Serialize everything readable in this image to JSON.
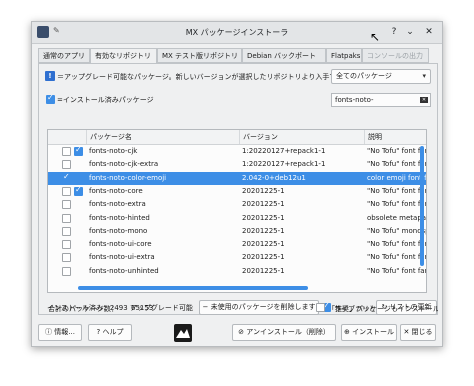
{
  "window": {
    "title": "MX パッケージインストーラ"
  },
  "tabs": [
    {
      "label": "通常のアプリ"
    },
    {
      "label": "有効なリポジトリ"
    },
    {
      "label": "MX テスト版リポジトリ"
    },
    {
      "label": "Debian バックポート"
    },
    {
      "label": "Flatpaks"
    },
    {
      "label": "コンソールの出力"
    }
  ],
  "legend": {
    "upgrade_badge": "!",
    "upgrade_text": "＝アップグレード可能なパッケージ。新しいバージョンが選択したリポジトリより入手でき",
    "installed_text": "=インストール済みパッケージ"
  },
  "filter": {
    "selected": "全てのパッケージ"
  },
  "search": {
    "value": "fonts-noto-"
  },
  "table": {
    "headers": [
      "パッケージ名",
      "バージョン",
      "説明"
    ],
    "rows": [
      {
        "checked": false,
        "installed": true,
        "name": "fonts-noto-cjk",
        "version": "1:20220127+repack1-1",
        "desc": "\"No Tofu\" font famili",
        "selected": false
      },
      {
        "checked": false,
        "installed": false,
        "name": "fonts-noto-cjk-extra",
        "version": "1:20220127+repack1-1",
        "desc": "\"No Tofu\" font famili",
        "selected": false
      },
      {
        "checked": true,
        "installed": false,
        "name": "fonts-noto-color-emoji",
        "version": "2.042-0+deb12u1",
        "desc": "color emoji font from",
        "selected": true
      },
      {
        "checked": false,
        "installed": true,
        "name": "fonts-noto-core",
        "version": "20201225-1",
        "desc": "\"No Tofu\" font famili",
        "selected": false
      },
      {
        "checked": false,
        "installed": false,
        "name": "fonts-noto-extra",
        "version": "20201225-1",
        "desc": "\"No Tofu\" font famili",
        "selected": false
      },
      {
        "checked": false,
        "installed": false,
        "name": "fonts-noto-hinted",
        "version": "20201225-1",
        "desc": "obsolete metapacka",
        "selected": false
      },
      {
        "checked": false,
        "installed": false,
        "name": "fonts-noto-mono",
        "version": "20201225-1",
        "desc": "\"No Tofu\" monospac",
        "selected": false
      },
      {
        "checked": false,
        "installed": false,
        "name": "fonts-noto-ui-core",
        "version": "20201225-1",
        "desc": "\"No Tofu\" font famili",
        "selected": false
      },
      {
        "checked": false,
        "installed": false,
        "name": "fonts-noto-ui-extra",
        "version": "20201225-1",
        "desc": "\"No Tofu\" font famili",
        "selected": false
      },
      {
        "checked": false,
        "installed": false,
        "name": "fonts-noto-unhinted",
        "version": "20201225-1",
        "desc": "\"No Tofu\" font famili",
        "selected": false
      }
    ]
  },
  "stats": {
    "total_label": "合計のパッケージ数：",
    "total_value": "65153",
    "installed_line": "インストール済み：2493  アップグレード可能"
  },
  "actions": {
    "remove_unused": "未使用のパッケージを削除します",
    "libraries": "ライブラリと開",
    "refresh_list": "リストの更新",
    "recommends": "「推奨」パッケージもインストール"
  },
  "footer": {
    "info": "情報...",
    "help": "ヘルプ",
    "uninstall": "アンインストール（削除）",
    "install": "インストール",
    "close": "閉じる"
  },
  "colors": {
    "accent": "#3d8ee6",
    "upgrade_badge": "#2e6fd0"
  }
}
